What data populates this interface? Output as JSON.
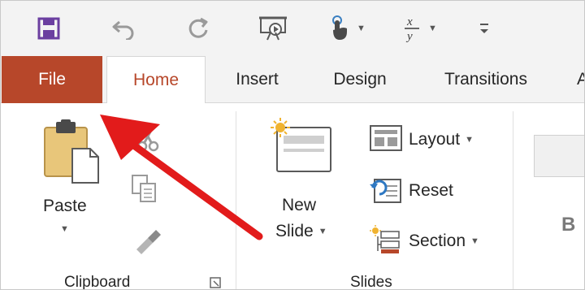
{
  "quick_access": {
    "items": [
      {
        "icon": "save-icon"
      },
      {
        "icon": "undo-icon"
      },
      {
        "icon": "redo-icon"
      },
      {
        "icon": "present-from-start-icon"
      },
      {
        "icon": "touch-mode-icon"
      },
      {
        "icon": "equation-icon"
      },
      {
        "icon": "customize-qat-icon"
      }
    ]
  },
  "tabs": {
    "file": "File",
    "home": "Home",
    "insert": "Insert",
    "design": "Design",
    "transitions": "Transitions",
    "more": "A"
  },
  "ribbon": {
    "clipboard": {
      "paste_label": "Paste",
      "group_label": "Clipboard"
    },
    "slides": {
      "new_slide_line1": "New",
      "new_slide_line2": "Slide",
      "layout_label": "Layout",
      "reset_label": "Reset",
      "section_label": "Section",
      "group_label": "Slides"
    },
    "font": {
      "bold_label": "B"
    }
  },
  "colors": {
    "file_tab": "#b7472a",
    "home_tab_text": "#b7472a",
    "annotation_arrow": "#e21b1b",
    "save_icon": "#6b3fa0"
  }
}
